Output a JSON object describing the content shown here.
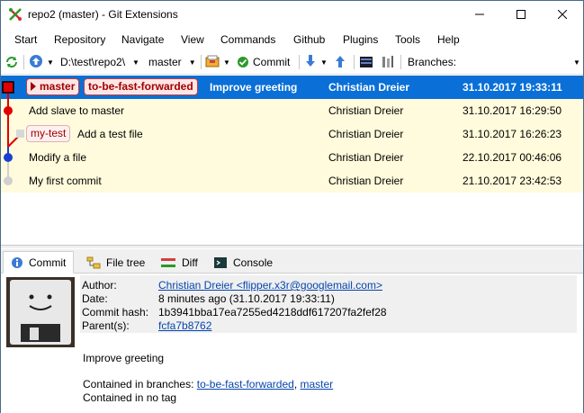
{
  "window": {
    "title": "repo2 (master) - Git Extensions"
  },
  "menu": [
    "Start",
    "Repository",
    "Navigate",
    "View",
    "Commands",
    "Github",
    "Plugins",
    "Tools",
    "Help"
  ],
  "toolbar": {
    "path": "D:\\test\\repo2\\",
    "branch": "master",
    "commit_label": "Commit",
    "branches_label": "Branches:"
  },
  "revisions": [
    {
      "message": "Improve greeting",
      "author": "Christian Dreier",
      "date": "31.10.2017 19:33:11",
      "refs": [
        "master",
        "to-be-fast-forwarded"
      ],
      "selected": true
    },
    {
      "message": "Add slave to master",
      "author": "Christian Dreier",
      "date": "31.10.2017 16:29:50",
      "refs": [],
      "selected": false
    },
    {
      "message": "Add a test file",
      "author": "Christian Dreier",
      "date": "31.10.2017 16:26:23",
      "refs": [
        "my-test"
      ],
      "selected": false
    },
    {
      "message": "Modify a file",
      "author": "Christian Dreier",
      "date": "22.10.2017 00:46:06",
      "refs": [],
      "selected": false
    },
    {
      "message": "My first commit",
      "author": "Christian Dreier",
      "date": "21.10.2017 23:42:53",
      "refs": [],
      "selected": false
    }
  ],
  "tabs": [
    {
      "label": "Commit",
      "icon": "info-icon"
    },
    {
      "label": "File tree",
      "icon": "file-tree-icon"
    },
    {
      "label": "Diff",
      "icon": "diff-icon"
    },
    {
      "label": "Console",
      "icon": "console-icon"
    }
  ],
  "commit": {
    "author_label": "Author:",
    "author_value": "Christian Dreier <flipper.x3r@googlemail.com>",
    "date_label": "Date:",
    "date_value": "8 minutes ago (31.10.2017 19:33:11)",
    "hash_label": "Commit hash:",
    "hash_value": "1b3941bba17ea7255ed4218ddf617207fa2fef28",
    "parents_label": "Parent(s):",
    "parents_value": "fcfa7b8762",
    "message": "Improve greeting",
    "contained_branches_label": "Contained in branches:",
    "contained_branch_1": "to-be-fast-forwarded",
    "contained_sep": ",",
    "contained_branch_2": "master",
    "contained_tag": "Contained in no tag"
  },
  "colors": {
    "selection": "#0a6fd6",
    "row_background": "#fffbdc",
    "graph_red": "#e00000",
    "graph_blue": "#1a3fd0",
    "link": "#0645ad"
  }
}
